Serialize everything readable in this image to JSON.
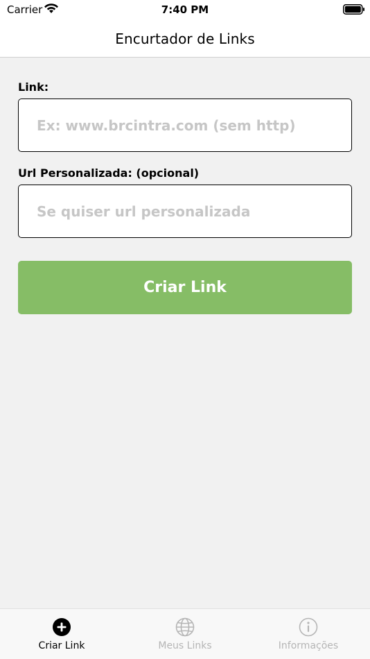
{
  "status_bar": {
    "carrier": "Carrier",
    "time": "7:40 PM"
  },
  "nav": {
    "title": "Encurtador de Links"
  },
  "form": {
    "link_label": "Link:",
    "link_placeholder": "Ex: www.brcintra.com (sem http)",
    "link_value": "",
    "custom_label": "Url Personalizada: (opcional)",
    "custom_placeholder": "Se quiser url personalizada",
    "custom_value": "",
    "submit_label": "Criar Link"
  },
  "tabs": [
    {
      "label": "Criar Link",
      "icon": "plus-circle-icon",
      "active": true
    },
    {
      "label": "Meus Links",
      "icon": "globe-icon",
      "active": false
    },
    {
      "label": "Informações",
      "icon": "info-icon",
      "active": false
    }
  ],
  "colors": {
    "accent": "#86bd66",
    "background": "#f1f1f1",
    "inactive_tab": "#b5b5b5"
  }
}
